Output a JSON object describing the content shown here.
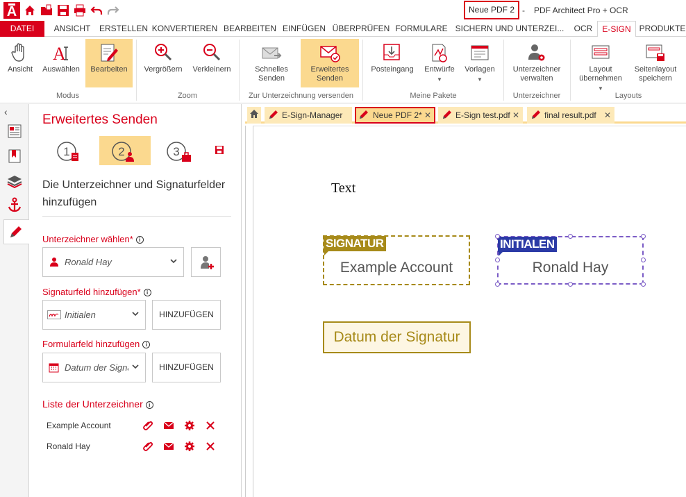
{
  "titlebar": {
    "doc_title": "Neue PDF 2",
    "separator": "-",
    "app_name": "PDF Architect Pro + OCR"
  },
  "ribbon_tabs": [
    "DATEI",
    "ANSICHT",
    "ERSTELLEN",
    "KONVERTIEREN",
    "BEARBEITEN",
    "EINFÜGEN",
    "ÜBERPRÜFEN",
    "FORMULARE",
    "SICHERN UND UNTERZEI...",
    "OCR",
    "E-SIGN",
    "PRODUKTE"
  ],
  "active_tab": "E-SIGN",
  "ribbon": {
    "modus": {
      "label": "Modus",
      "buttons": [
        "Ansicht",
        "Auswählen",
        "Bearbeiten"
      ]
    },
    "zoom": {
      "label": "Zoom",
      "buttons": [
        "Vergrößern",
        "Verkleinern"
      ]
    },
    "send": {
      "label": "Zur Unterzeichnung versenden",
      "buttons": [
        "Schnelles Senden",
        "Erweitertes Senden"
      ],
      "btn1_line1": "Schnelles",
      "btn1_line2": "Senden",
      "btn2_line1": "Erweitertes",
      "btn2_line2": "Senden"
    },
    "pakete": {
      "label": "Meine Pakete",
      "buttons": [
        "Posteingang",
        "Entwürfe",
        "Vorlagen"
      ]
    },
    "signer": {
      "label": "Unterzeichner",
      "line1": "Unterzeichner",
      "line2": "verwalten"
    },
    "layouts": {
      "label": "Layouts",
      "b1_line1": "Layout",
      "b1_line2": "übernehmen",
      "b2_line1": "Seitenlayout",
      "b2_line2": "speichern"
    }
  },
  "panel": {
    "title": "Erweitertes Senden",
    "subtitle": "Die Unterzeichner und Signaturfelder hinzufügen",
    "signer_label": "Unterzeichner wählen",
    "signer_value": "Ronald Hay",
    "sigfield_label": "Signaturfeld hinzufügen",
    "sigfield_value": "Initialen",
    "add_button": "HINZUFÜGEN",
    "formfield_label": "Formularfeld hinzufügen",
    "formfield_value": "Datum der Signatur",
    "list_label": "Liste der Unterzeichner",
    "asterisk": "*",
    "signers": [
      {
        "name": "Example Account"
      },
      {
        "name": "Ronald Hay"
      }
    ]
  },
  "doc_tabs": [
    {
      "name": "E-Sign-Manager"
    },
    {
      "name": "Neue PDF 2*"
    },
    {
      "name": "E-Sign test.pdf"
    },
    {
      "name": "final result.pdf"
    }
  ],
  "document": {
    "text": "Text",
    "signature": {
      "tag": "SIGNATUR",
      "value": "Example Account"
    },
    "initials": {
      "tag": "INITIALEN",
      "value": "Ronald Hay"
    },
    "date_field": "Datum der Signatur"
  },
  "colors": {
    "accent": "#d9001b",
    "selected_bg": "#fbd98f",
    "signature_gold": "#a78a19",
    "initials_blue": "#2b3aa6"
  }
}
